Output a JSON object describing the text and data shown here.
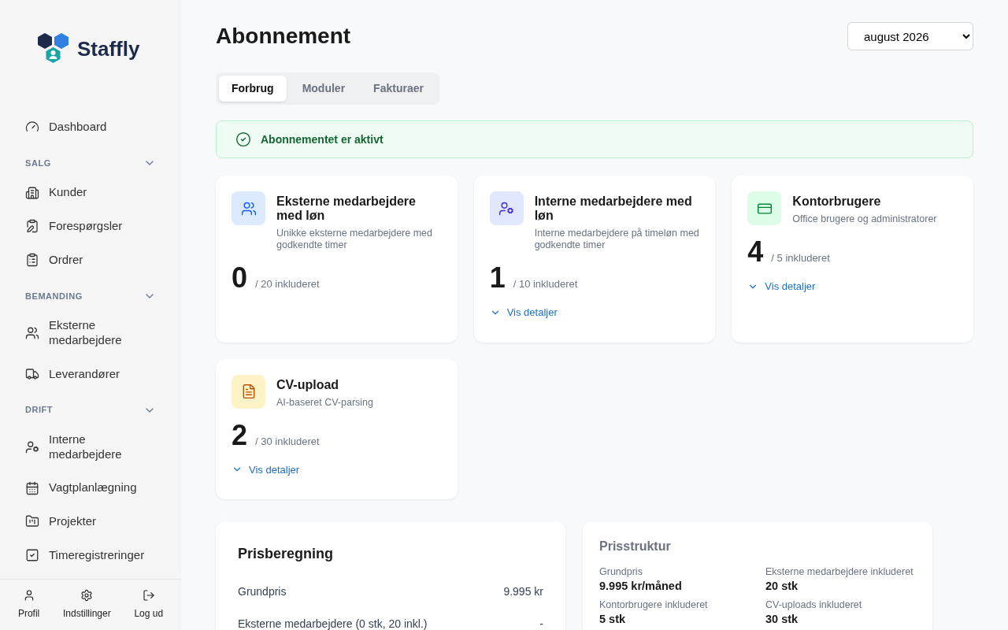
{
  "sidebar": {
    "logo": "Staffly",
    "items": [
      {
        "kind": "link",
        "label": "Dashboard"
      },
      {
        "kind": "section",
        "label": "SALG",
        "expanded": true,
        "children": [
          {
            "label": "Kunder"
          },
          {
            "label": "Forespørgsler"
          },
          {
            "label": "Ordrer"
          }
        ]
      },
      {
        "kind": "section",
        "label": "BEMANDING",
        "expanded": true,
        "children": [
          {
            "label": "Eksterne medarbejdere"
          },
          {
            "label": "Leverandører"
          }
        ]
      },
      {
        "kind": "section",
        "label": "DRIFT",
        "expanded": true,
        "children": [
          {
            "label": "Interne medarbejdere"
          },
          {
            "label": "Vagtplanlægning"
          },
          {
            "label": "Projekter"
          },
          {
            "label": "Timeregistreringer"
          }
        ]
      }
    ],
    "footer": [
      {
        "label": "Profil"
      },
      {
        "label": "Indstillinger"
      },
      {
        "label": "Log ud"
      }
    ]
  },
  "page": {
    "title": "Abonnement",
    "period": "august 2026"
  },
  "tabs": [
    {
      "label": "Forbrug",
      "selected": true
    },
    {
      "label": "Moduler",
      "selected": false
    },
    {
      "label": "Fakturaer",
      "selected": false
    }
  ],
  "status": {
    "text": "Abonnementet er aktivt",
    "active": true
  },
  "usage_cards": [
    {
      "title": "Eksterne medarbejdere med løn",
      "subtitle": "Unikke eksterne medarbejdere med godkendte timer",
      "count": "0",
      "included": "/ 20 inkluderet",
      "color": "#dbeafe"
    },
    {
      "title": "Interne medarbejdere med løn",
      "subtitle": "Interne medarbejdere på timeløn med godkendte timer",
      "count": "1",
      "included": "/ 10 inkluderet",
      "color": "#e0e7ff",
      "details": {
        "label": "Vis detaljer",
        "expanded": false
      }
    },
    {
      "title": "Kontorbrugere",
      "subtitle": "Office brugere og administratorer",
      "count": "4",
      "included": "/ 5 inkluderet",
      "color": "#dcfce7",
      "details": {
        "label": "Vis detaljer",
        "expanded": false
      }
    },
    {
      "title": "CV-upload",
      "subtitle": "AI-baseret CV-parsing",
      "count": "2",
      "included": "/ 30 inkluderet",
      "color": "#fef3c7",
      "details": {
        "label": "Vis detaljer",
        "expanded": false
      }
    }
  ],
  "price_calc": {
    "title": "Prisberegning",
    "rows": [
      {
        "label": "Grundpris",
        "value": "9.995 kr"
      },
      {
        "label": "Eksterne medarbejdere (0 stk, 20 inkl.)",
        "value": "-"
      }
    ]
  },
  "price_structure": {
    "title": "Prisstruktur",
    "items": [
      {
        "label": "Grundpris",
        "value": "9.995 kr/måned"
      },
      {
        "label": "Eksterne medarbejdere inkluderet",
        "value": "20 stk"
      },
      {
        "label": "Kontorbrugere inkluderet",
        "value": "5 stk"
      },
      {
        "label": "CV-uploads inkluderet",
        "value": "30 stk"
      }
    ]
  }
}
